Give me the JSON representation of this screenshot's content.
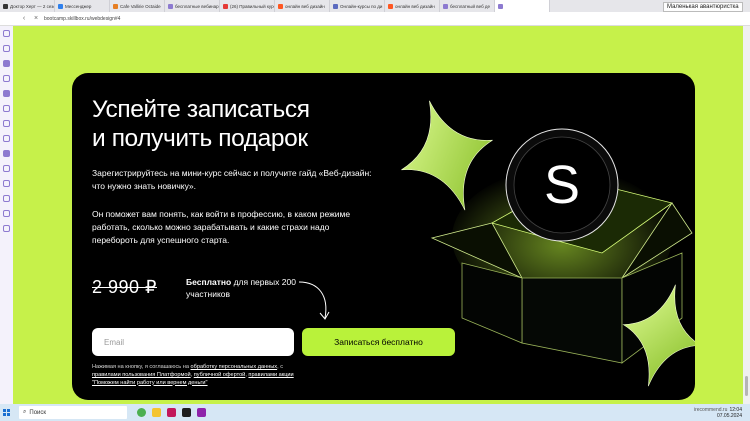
{
  "browser": {
    "tabs": [
      {
        "label": "Доктор Херт — 2 сезо",
        "color": "#333333"
      },
      {
        "label": "Мессенджер",
        "color": "#2f80ed"
      },
      {
        "label": "Cafe Vallirie Octaide",
        "color": "#e67e22"
      },
      {
        "label": "бесплатные вебинар",
        "color": "#8d7ad0"
      },
      {
        "label": "(26) Правильный курс",
        "color": "#e53935"
      },
      {
        "label": "онлайн веб дизайн",
        "color": "#ff5722"
      },
      {
        "label": "Онлайн-курсы по ди",
        "color": "#5c6bc0"
      },
      {
        "label": "онлайн веб дизайн",
        "color": "#ff5722"
      },
      {
        "label": "бесплатный веб де",
        "color": "#8d7ad0"
      },
      {
        "label": "",
        "color": "#8d7ad0"
      }
    ],
    "tab_tooltip": "Маленькая авантюристка",
    "url": "bootcamp.skillbox.ru/webdesign#4"
  },
  "promo": {
    "headline_line1": "Успейте записаться",
    "headline_line2": "и получить подарок",
    "description_1": "Зарегистрируйтесь на мини-курс сейчас и получите гайд «Веб-дизайн: что нужно знать новичку».",
    "description_2": "Он поможет вам понять, как войти в профессию, в каком режиме работать, сколько можно зарабатывать и какие страхи надо перебороть для успешного старта.",
    "old_price": "2 990 ₽",
    "free_bold": "Бесплатно",
    "free_rest": " для первых 200 участников",
    "email_placeholder": "Email",
    "signup_label": "Записаться бесплатно",
    "legal_text_1": "Нажимая на кнопку, я соглашаюсь на ",
    "legal_link_1": "обработку персональных данных",
    "legal_text_2": ", с ",
    "legal_link_2": "правилами пользования Платформой",
    "legal_text_3": ", ",
    "legal_link_3": "публичной офертой",
    "legal_text_4": ", ",
    "legal_link_4": "правилами акции \"Поможем найти работу или вернем деньги\"",
    "logo_letter": "S"
  },
  "taskbar": {
    "search_placeholder": "Поиск",
    "tray_line1": "12:04",
    "tray_line2": "07.05.2024"
  },
  "colors": {
    "page_bg": "#c6f14a",
    "card_bg": "#000000",
    "accent": "#b9f23a"
  },
  "watermark": "irecommend.ru"
}
